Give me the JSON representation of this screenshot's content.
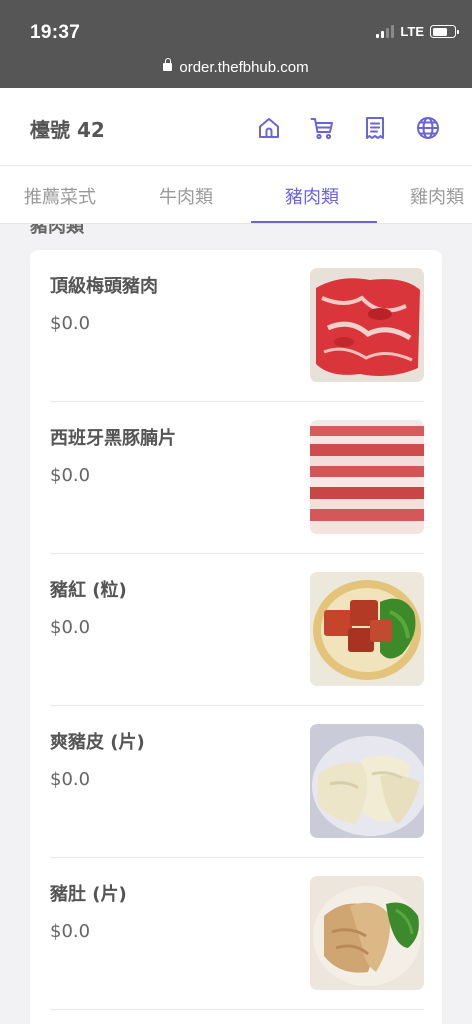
{
  "status_bar": {
    "time": "19:37",
    "network": "LTE",
    "url": "order.thefbhub.com"
  },
  "header": {
    "table_label": "檯號 42",
    "icons": [
      "home-icon",
      "cart-icon",
      "receipt-icon",
      "globe-icon"
    ],
    "accent_color": "#6b63d8"
  },
  "tabs": [
    {
      "label": "推薦菜式",
      "active": false
    },
    {
      "label": "牛肉類",
      "active": false
    },
    {
      "label": "豬肉類",
      "active": true
    },
    {
      "label": "雞肉類",
      "active": false
    }
  ],
  "section_title": "豬肉類",
  "items": [
    {
      "name": "頂級梅頭豬肉",
      "price": "$0.0",
      "image": "sliced-pork-shoulder"
    },
    {
      "name": "西班牙黑豚腩片",
      "price": "$0.0",
      "image": "pork-belly-slices"
    },
    {
      "name": "豬紅 (粒)",
      "price": "$0.0",
      "image": "pig-blood-cubes"
    },
    {
      "name": "爽豬皮 (片)",
      "price": "$0.0",
      "image": "pork-skin"
    },
    {
      "name": "豬肚 (片)",
      "price": "$0.0",
      "image": "pork-tripe"
    }
  ]
}
